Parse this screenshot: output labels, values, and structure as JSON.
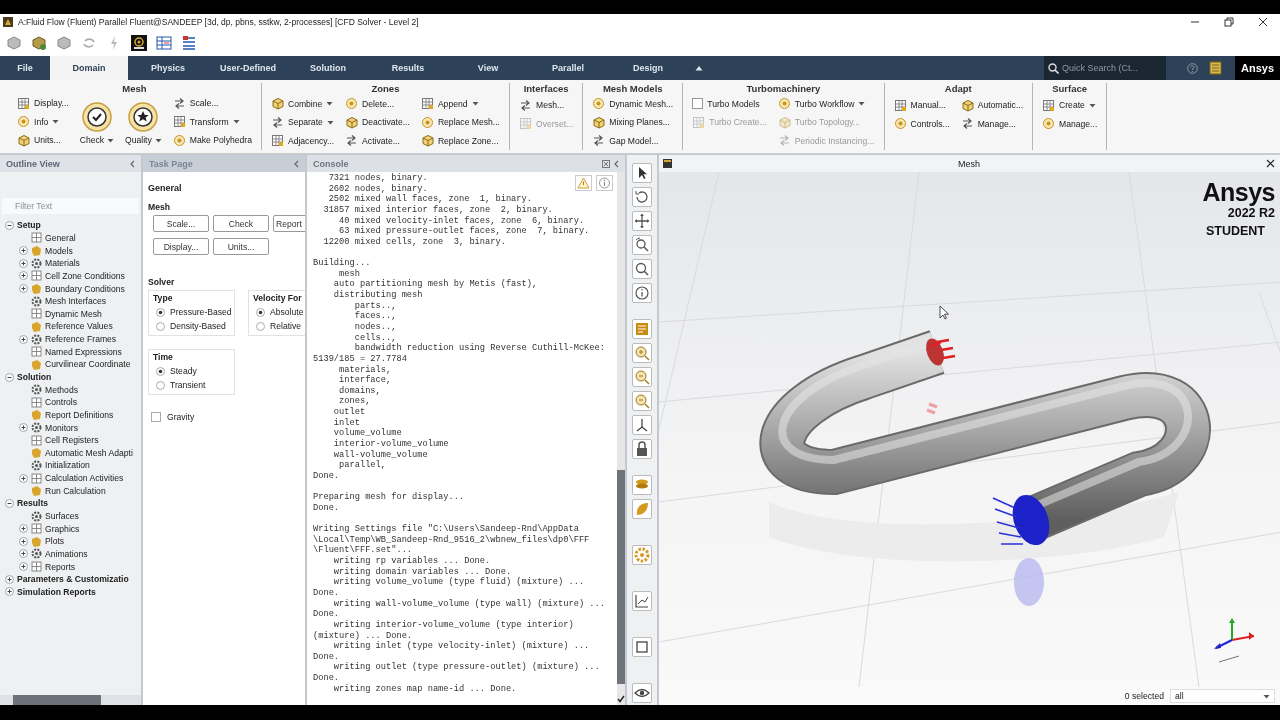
{
  "window": {
    "title": "A:Fluid Flow (Fluent) Parallel Fluent@SANDEEP  [3d, dp, pbns, sstkw, 2-processes] [CFD Solver - Level 2]"
  },
  "ribbon": {
    "tabs": [
      {
        "label": "File",
        "selected": false
      },
      {
        "label": "Domain",
        "selected": true
      },
      {
        "label": "Physics",
        "selected": false
      },
      {
        "label": "User-Defined",
        "selected": false
      },
      {
        "label": "Solution",
        "selected": false
      },
      {
        "label": "Results",
        "selected": false
      },
      {
        "label": "View",
        "selected": false
      },
      {
        "label": "Parallel",
        "selected": false
      },
      {
        "label": "Design",
        "selected": false
      }
    ],
    "search": {
      "placeholder": "Quick Search (Ct..."
    },
    "logo": "Ansys",
    "groups": [
      {
        "title": "Mesh",
        "columns": [
          [
            {
              "label": "Display...",
              "kind": "small",
              "disabled": false,
              "dropdown": false
            },
            {
              "label": "Info",
              "kind": "small",
              "disabled": false,
              "dropdown": true
            },
            {
              "label": "Units...",
              "kind": "small",
              "disabled": false,
              "dropdown": false
            }
          ],
          [
            {
              "label": "Check",
              "kind": "large",
              "disabled": false,
              "dropdown": true
            }
          ],
          [
            {
              "label": "Quality",
              "kind": "large",
              "disabled": false,
              "dropdown": true
            }
          ],
          [
            {
              "label": "Scale...",
              "kind": "small",
              "disabled": false,
              "dropdown": false
            },
            {
              "label": "Transform",
              "kind": "small",
              "disabled": false,
              "dropdown": true
            },
            {
              "label": "Make Polyhedra",
              "kind": "small",
              "disabled": false,
              "dropdown": false
            }
          ]
        ]
      },
      {
        "title": "Zones",
        "columns": [
          [
            {
              "label": "Combine",
              "kind": "small",
              "disabled": false,
              "dropdown": true
            },
            {
              "label": "Separate",
              "kind": "small",
              "disabled": false,
              "dropdown": true
            },
            {
              "label": "Adjacency...",
              "kind": "small",
              "disabled": false,
              "dropdown": false
            }
          ],
          [
            {
              "label": "Delete...",
              "kind": "small",
              "disabled": false,
              "dropdown": false
            },
            {
              "label": "Deactivate...",
              "kind": "small",
              "disabled": false,
              "dropdown": false
            },
            {
              "label": "Activate...",
              "kind": "small",
              "disabled": false,
              "dropdown": false
            }
          ],
          [
            {
              "label": "Append",
              "kind": "small",
              "disabled": false,
              "dropdown": true
            },
            {
              "label": "Replace Mesh...",
              "kind": "small",
              "disabled": false,
              "dropdown": false
            },
            {
              "label": "Replace Zone...",
              "kind": "small",
              "disabled": false,
              "dropdown": false
            }
          ]
        ]
      },
      {
        "title": "Interfaces",
        "columns": [
          [
            {
              "label": "Mesh...",
              "kind": "small",
              "disabled": false,
              "dropdown": false
            },
            {
              "label": "Overset...",
              "kind": "small",
              "disabled": true,
              "dropdown": false
            }
          ]
        ]
      },
      {
        "title": "Mesh Models",
        "columns": [
          [
            {
              "label": "Dynamic Mesh...",
              "kind": "small",
              "disabled": false,
              "dropdown": false
            },
            {
              "label": "Mixing Planes...",
              "kind": "small",
              "disabled": false,
              "dropdown": false
            },
            {
              "label": "Gap Model...",
              "kind": "small",
              "disabled": false,
              "dropdown": false
            }
          ]
        ]
      },
      {
        "title": "Turbomachinery",
        "columns": [
          [
            {
              "label": "Turbo Models",
              "kind": "checkbox",
              "checked": false,
              "disabled": false
            },
            {
              "label": "Turbo Create...",
              "kind": "small",
              "disabled": true,
              "dropdown": false
            }
          ],
          [
            {
              "label": "Turbo Workflow",
              "kind": "small",
              "disabled": false,
              "dropdown": true
            },
            {
              "label": "Turbo Topology...",
              "kind": "small",
              "disabled": true,
              "dropdown": false
            },
            {
              "label": "Periodic Instancing...",
              "kind": "small",
              "disabled": true,
              "dropdown": false
            }
          ]
        ]
      },
      {
        "title": "Adapt",
        "columns": [
          [
            {
              "label": "Manual...",
              "kind": "small",
              "disabled": false,
              "dropdown": false
            },
            {
              "label": "Controls...",
              "kind": "small",
              "disabled": false,
              "dropdown": false
            }
          ],
          [
            {
              "label": "Automatic...",
              "kind": "small",
              "disabled": false,
              "dropdown": false
            },
            {
              "label": "Manage...",
              "kind": "small",
              "disabled": false,
              "dropdown": false
            }
          ]
        ]
      },
      {
        "title": "Surface",
        "columns": [
          [
            {
              "label": "Create",
              "kind": "small",
              "disabled": false,
              "dropdown": true
            },
            {
              "label": "Manage...",
              "kind": "small",
              "disabled": false,
              "dropdown": false
            }
          ]
        ]
      }
    ]
  },
  "outline": {
    "title": "Outline View",
    "filter": {
      "placeholder": "Filter Text"
    },
    "tree": [
      {
        "label": "Setup",
        "kind": "branch",
        "expanded": true,
        "children": [
          {
            "label": "General",
            "kind": "leaf"
          },
          {
            "label": "Models",
            "kind": "branch",
            "expanded": false
          },
          {
            "label": "Materials",
            "kind": "branch",
            "expanded": false
          },
          {
            "label": "Cell Zone Conditions",
            "kind": "branch",
            "expanded": false
          },
          {
            "label": "Boundary Conditions",
            "kind": "branch",
            "expanded": false
          },
          {
            "label": "Mesh Interfaces",
            "kind": "leaf"
          },
          {
            "label": "Dynamic Mesh",
            "kind": "leaf"
          },
          {
            "label": "Reference Values",
            "kind": "leaf"
          },
          {
            "label": "Reference Frames",
            "kind": "branch",
            "expanded": false
          },
          {
            "label": "Named Expressions",
            "kind": "leaf"
          },
          {
            "label": "Curvilinear Coordinate",
            "kind": "leaf"
          }
        ]
      },
      {
        "label": "Solution",
        "kind": "branch",
        "expanded": true,
        "children": [
          {
            "label": "Methods",
            "kind": "leaf"
          },
          {
            "label": "Controls",
            "kind": "leaf"
          },
          {
            "label": "Report Definitions",
            "kind": "leaf"
          },
          {
            "label": "Monitors",
            "kind": "branch",
            "expanded": false
          },
          {
            "label": "Cell Registers",
            "kind": "leaf"
          },
          {
            "label": "Automatic Mesh Adapti",
            "kind": "leaf"
          },
          {
            "label": "Initialization",
            "kind": "leaf"
          },
          {
            "label": "Calculation Activities",
            "kind": "branch",
            "expanded": false
          },
          {
            "label": "Run Calculation",
            "kind": "leaf"
          }
        ]
      },
      {
        "label": "Results",
        "kind": "branch",
        "expanded": true,
        "children": [
          {
            "label": "Surfaces",
            "kind": "leaf"
          },
          {
            "label": "Graphics",
            "kind": "branch",
            "expanded": false
          },
          {
            "label": "Plots",
            "kind": "branch",
            "expanded": false
          },
          {
            "label": "Animations",
            "kind": "branch",
            "expanded": false
          },
          {
            "label": "Reports",
            "kind": "branch",
            "expanded": false
          }
        ]
      },
      {
        "label": "Parameters & Customizatio",
        "kind": "branch",
        "expanded": false
      },
      {
        "label": "Simulation Reports",
        "kind": "branch",
        "expanded": false
      }
    ]
  },
  "task_page": {
    "title": "Task Page",
    "heading": "General",
    "mesh": {
      "label": "Mesh",
      "buttons": [
        "Scale...",
        "Check",
        "Report",
        "Display...",
        "Units..."
      ]
    },
    "solver": {
      "label": "Solver",
      "groups": [
        {
          "title": "Type",
          "options": [
            {
              "label": "Pressure-Based",
              "selected": true
            },
            {
              "label": "Density-Based",
              "selected": false
            }
          ]
        },
        {
          "title": "Velocity For",
          "options": [
            {
              "label": "Absolute",
              "selected": true
            },
            {
              "label": "Relative",
              "selected": false
            }
          ]
        }
      ]
    },
    "time": {
      "title": "Time",
      "options": [
        {
          "label": "Steady",
          "selected": true
        },
        {
          "label": "Transient",
          "selected": false
        }
      ]
    },
    "gravity": {
      "label": "Gravity",
      "checked": false
    }
  },
  "console": {
    "title": "Console",
    "blocks": [
      [
        "   7321 nodes, binary.",
        "   2602 nodes, binary.",
        "   2502 mixed wall faces, zone  1, binary.",
        "  31857 mixed interior faces, zone  2, binary.",
        "     40 mixed velocity-inlet faces, zone  6, binary.",
        "     63 mixed pressure-outlet faces, zone  7, binary.",
        "  12200 mixed cells, zone  3, binary."
      ],
      [
        "Building...",
        "     mesh",
        "    auto partitioning mesh by Metis (fast),",
        "    distributing mesh",
        "        parts..,",
        "        faces..,",
        "        nodes..,",
        "        cells..,",
        "        bandwidth reduction using Reverse Cuthill-McKee:",
        "5139/185 = 27.7784",
        "     materials,",
        "     interface,",
        "     domains,",
        "     zones,",
        "    outlet",
        "    inlet",
        "    volume_volume",
        "    interior-volume_volume",
        "    wall-volume_volume",
        "     parallel,",
        "Done."
      ],
      [
        "Preparing mesh for display...",
        "Done."
      ],
      [
        "Writing Settings file \"C:\\Users\\Sandeep-Rnd\\AppData",
        "\\Local\\Temp\\WB_Sandeep-Rnd_9516_2\\wbnew_files\\dp0\\FFF",
        "\\Fluent\\FFF.set\"...",
        "    writing rp variables ... Done.",
        "    writing domain variables ... Done.",
        "    writing volume_volume (type fluid) (mixture) ...",
        "Done.",
        "    writing wall-volume_volume (type wall) (mixture) ...",
        "Done.",
        "    writing interior-volume_volume (type interior)",
        "(mixture) ... Done.",
        "    writing inlet (type velocity-inlet) (mixture) ...",
        "Done.",
        "    writing outlet (type pressure-outlet) (mixture) ...",
        "Done.",
        "    writing zones map name-id ... Done."
      ]
    ]
  },
  "viewport": {
    "title": "Mesh",
    "logo": {
      "brand": "Ansys",
      "version": "2022 R2",
      "edition": "STUDENT"
    },
    "selection": {
      "count": "0 selected",
      "filter": "all"
    }
  }
}
